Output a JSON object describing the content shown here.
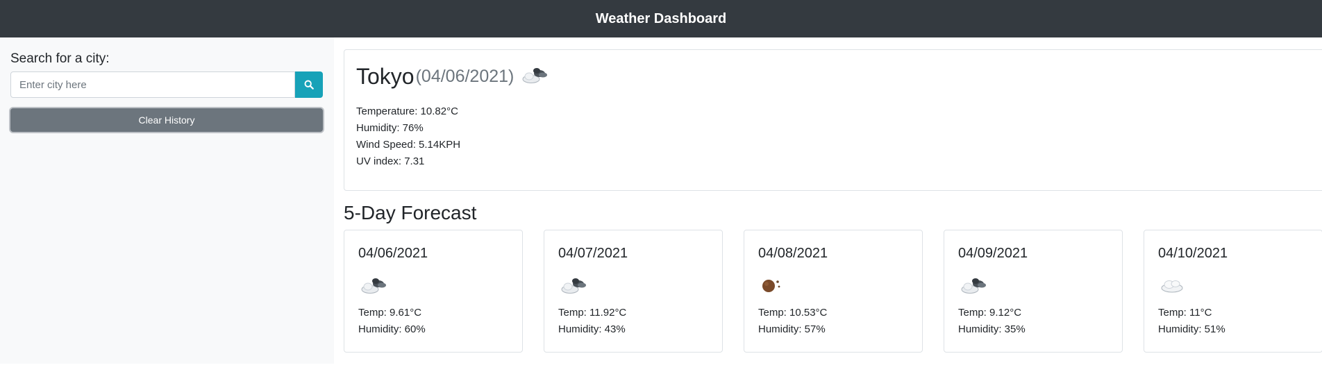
{
  "header": {
    "title": "Weather Dashboard"
  },
  "sidebar": {
    "search_label": "Search for a city:",
    "search_placeholder": "Enter city here",
    "search_value": "",
    "search_icon": "search-icon",
    "clear_label": "Clear History"
  },
  "current": {
    "city": "Tokyo",
    "date": "(04/06/2021)",
    "icon": "cloud-sun-icon",
    "temperature": "Temperature: 10.82°C",
    "humidity": "Humidity: 76%",
    "wind": "Wind Speed: 5.14KPH",
    "uv": "UV index: 7.31"
  },
  "forecast": {
    "heading": "5-Day Forecast",
    "days": [
      {
        "date": "04/06/2021",
        "icon": "cloud-dark-icon",
        "temp": "Temp: 9.61°C",
        "humidity": "Humidity: 60%"
      },
      {
        "date": "04/07/2021",
        "icon": "cloud-dark-icon",
        "temp": "Temp: 11.92°C",
        "humidity": "Humidity: 43%"
      },
      {
        "date": "04/08/2021",
        "icon": "moon-icon",
        "temp": "Temp: 10.53°C",
        "humidity": "Humidity: 57%"
      },
      {
        "date": "04/09/2021",
        "icon": "cloud-dark-icon",
        "temp": "Temp: 9.12°C",
        "humidity": "Humidity: 35%"
      },
      {
        "date": "04/10/2021",
        "icon": "cloud-icon",
        "temp": "Temp: 11°C",
        "humidity": "Humidity: 51%"
      }
    ]
  },
  "colors": {
    "navbar": "#343a40",
    "accent": "#17a2b8",
    "secondary": "#6c757d"
  }
}
